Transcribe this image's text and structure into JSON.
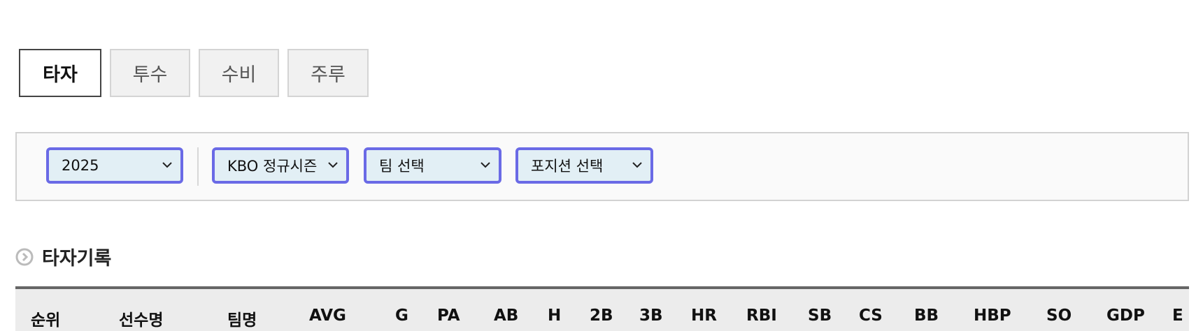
{
  "tabs": [
    {
      "label": "타자",
      "active": true
    },
    {
      "label": "투수",
      "active": false
    },
    {
      "label": "수비",
      "active": false
    },
    {
      "label": "주루",
      "active": false
    }
  ],
  "filters": {
    "year": "2025",
    "season": "KBO 정규시즌",
    "team": "팀 선택",
    "position": "포지션 선택",
    "select_border_color": "#6a6ae6",
    "select_bg_color": "#e2eff5"
  },
  "section": {
    "icon": "circle-chevron-right-icon",
    "title": "타자기록"
  },
  "table": {
    "columns": [
      "순위",
      "선수명",
      "팀명",
      "AVG",
      "G",
      "PA",
      "AB",
      "H",
      "2B",
      "3B",
      "HR",
      "RBI",
      "SB",
      "CS",
      "BB",
      "HBP",
      "SO",
      "GDP",
      "E"
    ]
  }
}
